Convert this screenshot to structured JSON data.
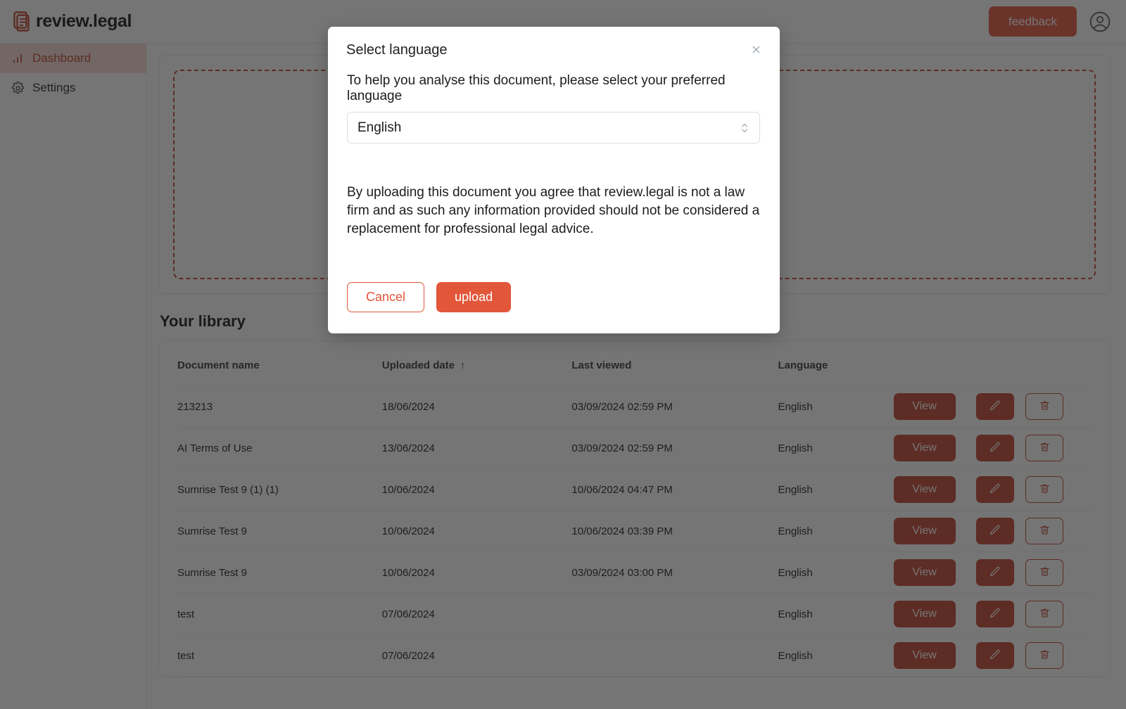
{
  "brand": {
    "name": "review.legal",
    "logo_icon": "document-lines-icon",
    "accent": "#C0402A"
  },
  "topbar": {
    "feedback_label": "feedback",
    "avatar_icon": "user-circle-icon"
  },
  "sidebar": {
    "items": [
      {
        "label": "Dashboard",
        "icon": "bar-chart-icon",
        "active": true
      },
      {
        "label": "Settings",
        "icon": "gear-icon",
        "active": false
      }
    ]
  },
  "upload": {
    "dropzone_text": ""
  },
  "library": {
    "title": "Your library",
    "columns": [
      {
        "label": "Document name",
        "sorted": false
      },
      {
        "label": "Uploaded date",
        "sorted": true,
        "sort_arrow": "↑"
      },
      {
        "label": "Last viewed",
        "sorted": false
      },
      {
        "label": "Language",
        "sorted": false
      }
    ],
    "row_actions": {
      "view_label": "View",
      "edit_icon": "pencil-icon",
      "delete_icon": "trash-icon"
    },
    "rows": [
      {
        "name": "213213",
        "uploaded": "18/06/2024",
        "viewed": "03/09/2024 02:59 PM",
        "language": "English"
      },
      {
        "name": "AI Terms of Use",
        "uploaded": "13/06/2024",
        "viewed": "03/09/2024 02:59 PM",
        "language": "English"
      },
      {
        "name": "Sumrise Test 9 (1) (1)",
        "uploaded": "10/06/2024",
        "viewed": "10/06/2024 04:47 PM",
        "language": "English"
      },
      {
        "name": "Sumrise Test 9",
        "uploaded": "10/06/2024",
        "viewed": "10/06/2024 03:39 PM",
        "language": "English"
      },
      {
        "name": "Sumrise Test 9",
        "uploaded": "10/06/2024",
        "viewed": "03/09/2024 03:00 PM",
        "language": "English"
      },
      {
        "name": "test",
        "uploaded": "07/06/2024",
        "viewed": "",
        "language": "English"
      },
      {
        "name": "test",
        "uploaded": "07/06/2024",
        "viewed": "",
        "language": "English"
      }
    ]
  },
  "modal": {
    "title": "Select language",
    "close_icon": "close-icon",
    "prompt": "To help you analyse this document, please select your preferred language",
    "selected_language": "English",
    "stepper_icon": "chevron-up-down-icon",
    "disclaimer": "By uploading this document you agree that review.legal is not a law firm and as such any information provided should not be considered a replacement for professional legal advice.",
    "cancel_label": "Cancel",
    "upload_label": "upload"
  }
}
